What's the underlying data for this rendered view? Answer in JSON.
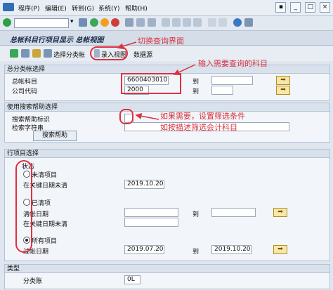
{
  "menu": {
    "items": [
      "程序(P)",
      "编辑(E)",
      "转到(G)",
      "系统(Y)",
      "帮助(H)"
    ]
  },
  "title": "总帐科目行项目显示 总帐视图",
  "app_toolbar": {
    "btn_choose_layout": "选择分类帐",
    "btn_entry_view": "录入视图",
    "btn_datasource": "数据源"
  },
  "sections": {
    "gl_selection": {
      "header": "总分类帐选择",
      "account_label": "总帐科目",
      "account_value": "6600403010",
      "company_label": "公司代码",
      "company_value": "2000",
      "to_label": "到"
    },
    "search_help": {
      "header": "使用搜索帮助选择",
      "flag_label": "搜索帮助标识",
      "string_label": "检索字符串",
      "button_label": "搜索帮助"
    },
    "line_items": {
      "header": "行项目选择",
      "status_label": "状态",
      "open_items_label": "未清项目",
      "open_key_date_label": "在关键日期未清",
      "open_key_date_value": "2019.10.20",
      "cleared_items_label": "已清项",
      "clearing_date_label": "清帐日期",
      "cleared_key_date_label": "在关键日期未清",
      "all_items_label": "所有项目",
      "posting_date_label": "过帐日期",
      "posting_date_from": "2019.07.20",
      "posting_date_to": "2019.10.20",
      "to_label": "到",
      "selected": "all_items"
    },
    "type": {
      "header": "类型",
      "ledger_label": "分类账",
      "ledger_value": "0L"
    }
  },
  "annotations": {
    "switch_view": "切换查询界面",
    "enter_account": "输入需要查询的科目",
    "filter_line1": "如果需要，设置筛选条件",
    "filter_line2": "如按描述筛选会计科目"
  },
  "colors": {
    "annotation": "#d8333f",
    "input_highlight_border": "#e03040"
  }
}
